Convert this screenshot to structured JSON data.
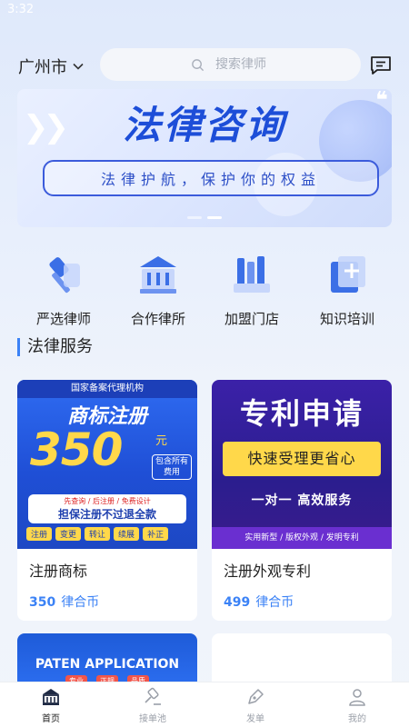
{
  "status": {
    "time": "3:32"
  },
  "header": {
    "city": "广州市",
    "search_placeholder": "搜索律师"
  },
  "banner": {
    "title": "法律咨询",
    "slogan": "法律护航，保护你的权益",
    "active_slide": 2,
    "slide_count": 2
  },
  "quick_actions": [
    {
      "label": "严选律师",
      "icon": "gavel-icon"
    },
    {
      "label": "合作律所",
      "icon": "courthouse-icon"
    },
    {
      "label": "加盟门店",
      "icon": "books-icon"
    },
    {
      "label": "知识培训",
      "icon": "add-book-icon"
    }
  ],
  "section": {
    "title": "法律服务"
  },
  "services": [
    {
      "name": "注册商标",
      "price": "350",
      "unit": "律合币",
      "image": {
        "header": "国家备案代理机构",
        "title": "商标注册",
        "big": "350",
        "currency": "元",
        "included": "包含所有费用",
        "note": "先查询 / 后注册 / 免费设计",
        "guarantee": "担保注册不过退全款",
        "tags": [
          "注册",
          "变更",
          "转让",
          "续展",
          "补正"
        ]
      }
    },
    {
      "name": "注册外观专利",
      "price": "499",
      "unit": "律合币",
      "image": {
        "title": "专利申请",
        "highlight": "快速受理更省心",
        "tagline": "一对一 高效服务",
        "footer": "实用新型 / 版权外观 / 发明专利"
      }
    },
    {
      "name": "",
      "price": "",
      "unit": "",
      "image": {
        "title": "PATEN APPLICATION",
        "chips": [
          "专业",
          "正规",
          "品质"
        ]
      }
    }
  ],
  "nav": [
    {
      "label": "首页",
      "active": true
    },
    {
      "label": "接单池",
      "active": false
    },
    {
      "label": "发单",
      "active": false
    },
    {
      "label": "我的",
      "active": false
    }
  ],
  "colors": {
    "accent": "#3b82f6",
    "brand_blue": "#1d4ed8",
    "gold": "#ffd84a"
  }
}
